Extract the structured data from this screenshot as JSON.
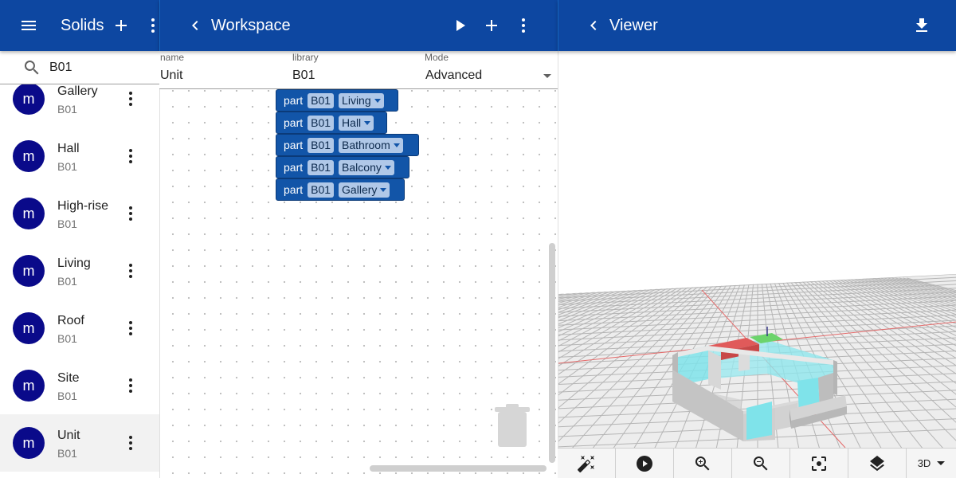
{
  "solids_panel": {
    "title": "Solids",
    "search": {
      "value": "B01",
      "placeholder": ""
    },
    "items": [
      {
        "avatar": "m",
        "name": "Gallery",
        "library": "B01"
      },
      {
        "avatar": "m",
        "name": "Hall",
        "library": "B01"
      },
      {
        "avatar": "m",
        "name": "High-rise",
        "library": "B01"
      },
      {
        "avatar": "m",
        "name": "Living",
        "library": "B01"
      },
      {
        "avatar": "m",
        "name": "Roof",
        "library": "B01"
      },
      {
        "avatar": "m",
        "name": "Site",
        "library": "B01"
      },
      {
        "avatar": "m",
        "name": "Unit",
        "library": "B01",
        "selected": true
      }
    ]
  },
  "workspace": {
    "title": "Workspace",
    "props": {
      "name_label": "name",
      "name_value": "Unit",
      "library_label": "library",
      "library_value": "B01",
      "mode_label": "Mode",
      "mode_value": "Advanced"
    },
    "blocks": [
      {
        "keyword": "part",
        "library": "B01",
        "solid": "Living"
      },
      {
        "keyword": "part",
        "library": "B01",
        "solid": "Hall"
      },
      {
        "keyword": "part",
        "library": "B01",
        "solid": "Bathroom"
      },
      {
        "keyword": "part",
        "library": "B01",
        "solid": "Balcony"
      },
      {
        "keyword": "part",
        "library": "B01",
        "solid": "Gallery"
      }
    ]
  },
  "viewer": {
    "title": "Viewer",
    "view_mode": "3D",
    "colors": {
      "appbar": "#0d47a1",
      "glass": "#7fe3ea",
      "red_room": "#e05a5a",
      "green_room": "#6cd46c",
      "wall": "#cfcfcf"
    }
  },
  "icons": [
    "menu-icon",
    "add-icon",
    "more-vert-icon",
    "chevron-left-icon",
    "play-icon",
    "download-icon",
    "search-icon",
    "auto-fix-icon",
    "zoom-in-icon",
    "zoom-out-icon",
    "center-focus-icon",
    "layers-icon",
    "trash-icon"
  ]
}
